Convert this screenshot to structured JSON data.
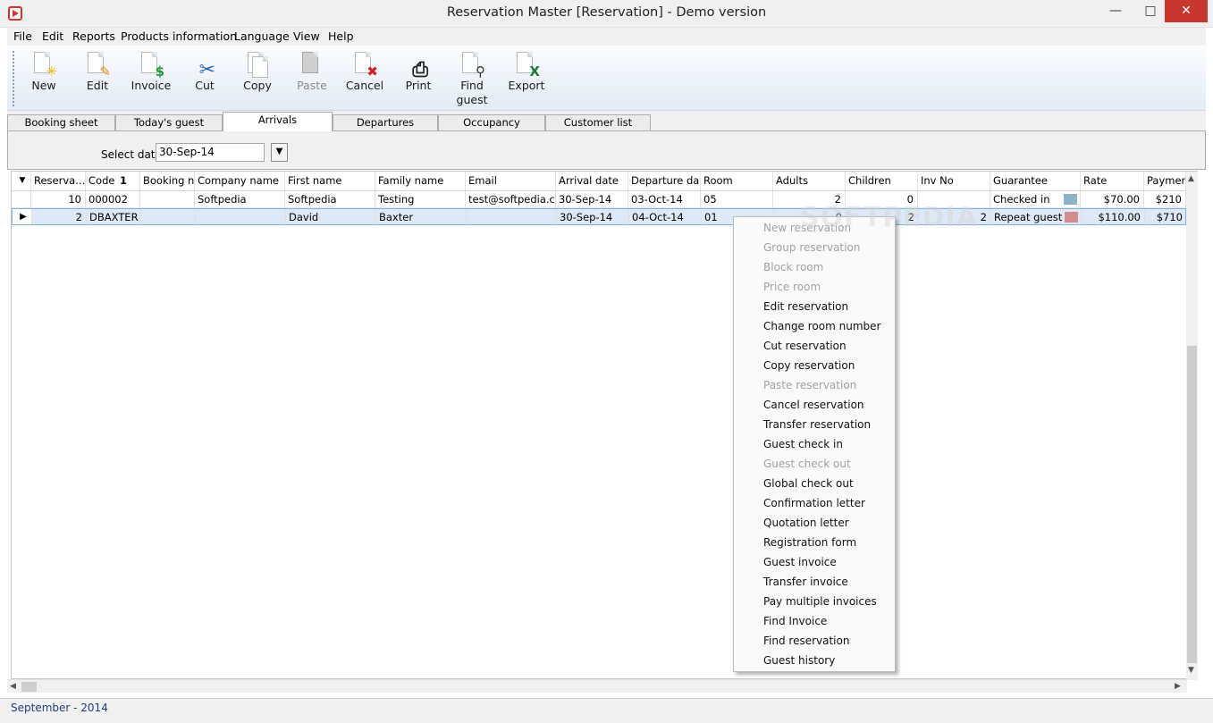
{
  "window": {
    "title": "Reservation Master [Reservation] - Demo version",
    "controls": [
      "minimize",
      "maximize",
      "close"
    ]
  },
  "menu": [
    "File",
    "Edit",
    "Reports",
    "Products information",
    "Language",
    "View",
    "Help"
  ],
  "toolbar": [
    {
      "label": "New",
      "icon": "new-document-icon",
      "enabled": true
    },
    {
      "label": "Edit",
      "icon": "edit-document-icon",
      "enabled": true
    },
    {
      "label": "Invoice",
      "icon": "invoice-dollar-icon",
      "enabled": true
    },
    {
      "label": "Cut",
      "icon": "scissors-icon",
      "enabled": true
    },
    {
      "label": "Copy",
      "icon": "copy-document-icon",
      "enabled": true
    },
    {
      "label": "Paste",
      "icon": "paste-clipboard-icon",
      "enabled": false
    },
    {
      "label": "Cancel",
      "icon": "cancel-x-icon",
      "enabled": true
    },
    {
      "label": "Print",
      "icon": "printer-icon",
      "enabled": true
    },
    {
      "label": "Find guest",
      "icon": "magnifier-icon",
      "enabled": true
    },
    {
      "label": "Export",
      "icon": "excel-export-icon",
      "enabled": true
    }
  ],
  "tabs": [
    {
      "label": "Booking sheet",
      "active": false
    },
    {
      "label": "Today's guest",
      "active": false
    },
    {
      "label": "Arrivals",
      "active": true
    },
    {
      "label": "Departures",
      "active": false
    },
    {
      "label": "Occupancy",
      "active": false
    },
    {
      "label": "Customer list",
      "active": false
    }
  ],
  "filter": {
    "label": "Select date",
    "value": "30-Sep-14"
  },
  "grid": {
    "sort_indicator": "1",
    "columns": [
      "Reserva...",
      "Code",
      "Booking no",
      "Company name",
      "First name",
      "Family name",
      "Email",
      "Arrival date",
      "Departure date",
      "Room",
      "Adults",
      "Children",
      "Inv No",
      "Guarantee",
      "Rate",
      "Payment"
    ],
    "rows": [
      {
        "selected": false,
        "cells": [
          "10",
          "000002",
          "",
          "Softpedia",
          "Softpedia",
          "Testing",
          "test@softpedia.com",
          "30-Sep-14",
          "03-Oct-14",
          "05",
          "2",
          "0",
          "",
          "Checked in",
          "$70.00",
          "$210"
        ],
        "guarantee_color": "#8fb3c6"
      },
      {
        "selected": true,
        "cells": [
          "2",
          "DBAXTER",
          "",
          "",
          "David",
          "Baxter",
          "",
          "30-Sep-14",
          "04-Oct-14",
          "01",
          "0",
          "2",
          "2",
          "Repeat guest",
          "$110.00",
          "$710"
        ],
        "guarantee_color": "#d48b8b"
      }
    ]
  },
  "context_menu": [
    {
      "label": "New reservation",
      "enabled": false
    },
    {
      "label": "Group reservation",
      "enabled": false
    },
    {
      "label": "Block room",
      "enabled": false
    },
    {
      "label": "Price room",
      "enabled": false
    },
    {
      "label": "Edit reservation",
      "enabled": true
    },
    {
      "label": "Change room number",
      "enabled": true
    },
    {
      "label": "Cut reservation",
      "enabled": true
    },
    {
      "label": "Copy reservation",
      "enabled": true
    },
    {
      "label": "Paste reservation",
      "enabled": false
    },
    {
      "label": "Cancel reservation",
      "enabled": true
    },
    {
      "label": "Transfer reservation",
      "enabled": true
    },
    {
      "label": "Guest check in",
      "enabled": true
    },
    {
      "label": "Guest check out",
      "enabled": false
    },
    {
      "label": "Global check out",
      "enabled": true
    },
    {
      "label": "Confirmation letter",
      "enabled": true
    },
    {
      "label": "Quotation letter",
      "enabled": true
    },
    {
      "label": "Registration form",
      "enabled": true
    },
    {
      "label": "Guest invoice",
      "enabled": true
    },
    {
      "label": "Transfer invoice",
      "enabled": true
    },
    {
      "label": "Pay multiple invoices",
      "enabled": true
    },
    {
      "label": "Find Invoice",
      "enabled": true
    },
    {
      "label": "Find reservation",
      "enabled": true
    },
    {
      "label": "Guest history",
      "enabled": true
    }
  ],
  "status": "September - 2014",
  "watermark": "SOFTPEDIA"
}
